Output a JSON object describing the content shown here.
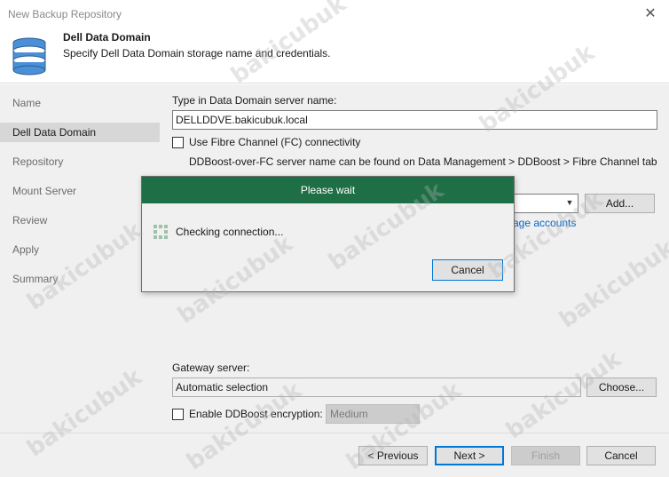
{
  "window": {
    "title": "New Backup Repository",
    "close_glyph": "✕"
  },
  "header": {
    "title": "Dell Data Domain",
    "subtitle": "Specify Dell Data Domain storage name and credentials.",
    "icon": "database-icon"
  },
  "sidebar": {
    "steps": [
      {
        "label": "Name",
        "active": false
      },
      {
        "label": "Dell Data Domain",
        "active": true
      },
      {
        "label": "Repository",
        "active": false
      },
      {
        "label": "Mount Server",
        "active": false
      },
      {
        "label": "Review",
        "active": false
      },
      {
        "label": "Apply",
        "active": false
      },
      {
        "label": "Summary",
        "active": false
      }
    ]
  },
  "form": {
    "server_name_label": "Type in Data Domain server name:",
    "server_name_value": "DELLDDVE.bakicubuk.local",
    "fibre_channel_label": "Use Fibre Channel (FC) connectivity",
    "fibre_channel_checked": false,
    "fc_hint": "DDBoost-over-FC server name can be found on Data Management > DDBoost > Fibre Channel tab",
    "add_button": "Add...",
    "manage_accounts_link": "age accounts",
    "gateway_label": "Gateway server:",
    "gateway_value": "Automatic selection",
    "choose_button": "Choose...",
    "encryption_label": "Enable DDBoost encryption:",
    "encryption_checked": false,
    "encryption_level": "Medium"
  },
  "footer": {
    "previous": "< Previous",
    "next": "Next >",
    "finish": "Finish",
    "cancel": "Cancel"
  },
  "dialog": {
    "title": "Please wait",
    "message": "Checking connection...",
    "cancel": "Cancel",
    "title_color": "#1e6e46"
  },
  "watermark": "bakicubuk"
}
